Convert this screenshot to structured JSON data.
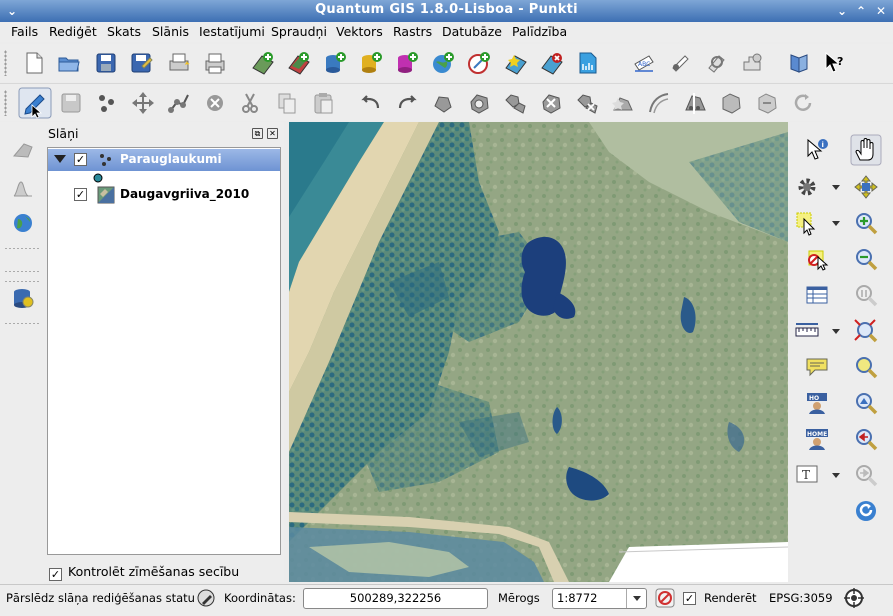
{
  "window": {
    "title": "Quantum GIS 1.8.0-Lisboa - Punkti"
  },
  "menu": [
    "Fails",
    "Rediģēt",
    "Skats",
    "Slānis",
    "Iestatījumi",
    "Spraudņi",
    "Vektors",
    "Rastrs",
    "Datubāze",
    "Palīdzība"
  ],
  "layers_panel": {
    "title": "Slāņi",
    "layers": [
      {
        "name": "Parauglaukumi",
        "checked": true,
        "selected": true,
        "expanded": true,
        "type": "point"
      },
      {
        "name": "Daugavgriiva_2010",
        "checked": true,
        "selected": false,
        "type": "raster"
      }
    ],
    "render_order_label": "Kontrolēt zīmēšanas secību",
    "render_order_checked": true
  },
  "statusbar": {
    "toggle_edit_label": "Pārslēdz slāņa rediģēšanas statu",
    "coords_label": "Koordinātas:",
    "coords_value": "500289,322256",
    "scale_label": "Mērogs",
    "scale_value": "1:8772",
    "render_label": "Renderēt",
    "render_checked": true,
    "crs": "EPSG:3059"
  },
  "colors": {
    "titlebar": "#4a7abf",
    "selection": "#7a9bd8",
    "map_land": "#9aab88",
    "map_water": "#1a3f7a"
  }
}
